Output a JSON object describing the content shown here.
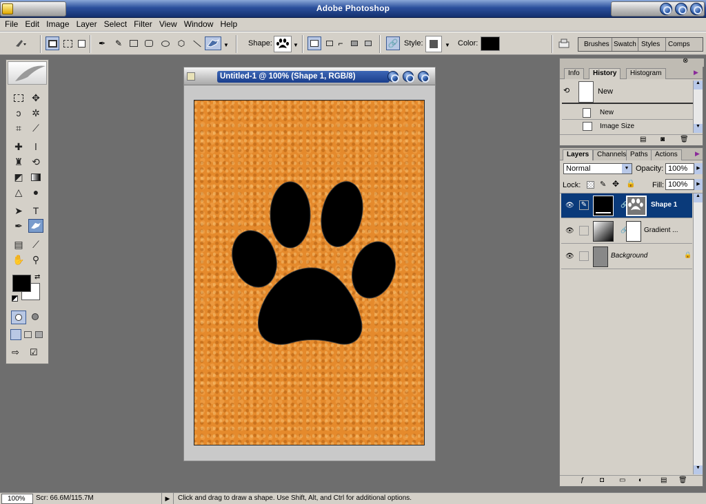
{
  "app": {
    "title": "Adobe Photoshop"
  },
  "menu": [
    "File",
    "Edit",
    "Image",
    "Layer",
    "Select",
    "Filter",
    "View",
    "Window",
    "Help"
  ],
  "options": {
    "shape_label": "Shape:",
    "style_label": "Style:",
    "color_label": "Color:",
    "color_value": "#000000",
    "style_swatch": "#555555",
    "well_tabs": [
      "Brushes",
      "Swatch",
      "Styles",
      "Comps"
    ]
  },
  "document": {
    "title": "Untitled-1 @ 100% (Shape 1, RGB/8)",
    "canvas_color": "#e58a2c"
  },
  "tools": {
    "foreground": "#000000",
    "background": "#ffffff"
  },
  "history_panel": {
    "tabs": [
      "Info",
      "History",
      "Histogram"
    ],
    "active_tab": "History",
    "snapshot_label": "New",
    "steps": [
      {
        "label": "New",
        "icon": "new-document-icon"
      },
      {
        "label": "Image Size",
        "icon": "image-size-icon"
      }
    ]
  },
  "layers_panel": {
    "tabs": [
      "Layers",
      "Channels",
      "Paths",
      "Actions"
    ],
    "blend_mode": "Normal",
    "opacity_label": "Opacity:",
    "opacity": "100%",
    "lock_label": "Lock:",
    "fill_label": "Fill:",
    "fill": "100%",
    "layers": [
      {
        "name": "Shape 1",
        "selected": true,
        "italic": false
      },
      {
        "name": "Gradient ...",
        "selected": false,
        "italic": false
      },
      {
        "name": "Background",
        "selected": false,
        "italic": true
      }
    ]
  },
  "status": {
    "zoom": "100%",
    "scratch": "Scr: 66.6M/115.7M",
    "hint": "Click and drag to draw a shape.  Use Shift, Alt, and Ctrl for additional options."
  }
}
